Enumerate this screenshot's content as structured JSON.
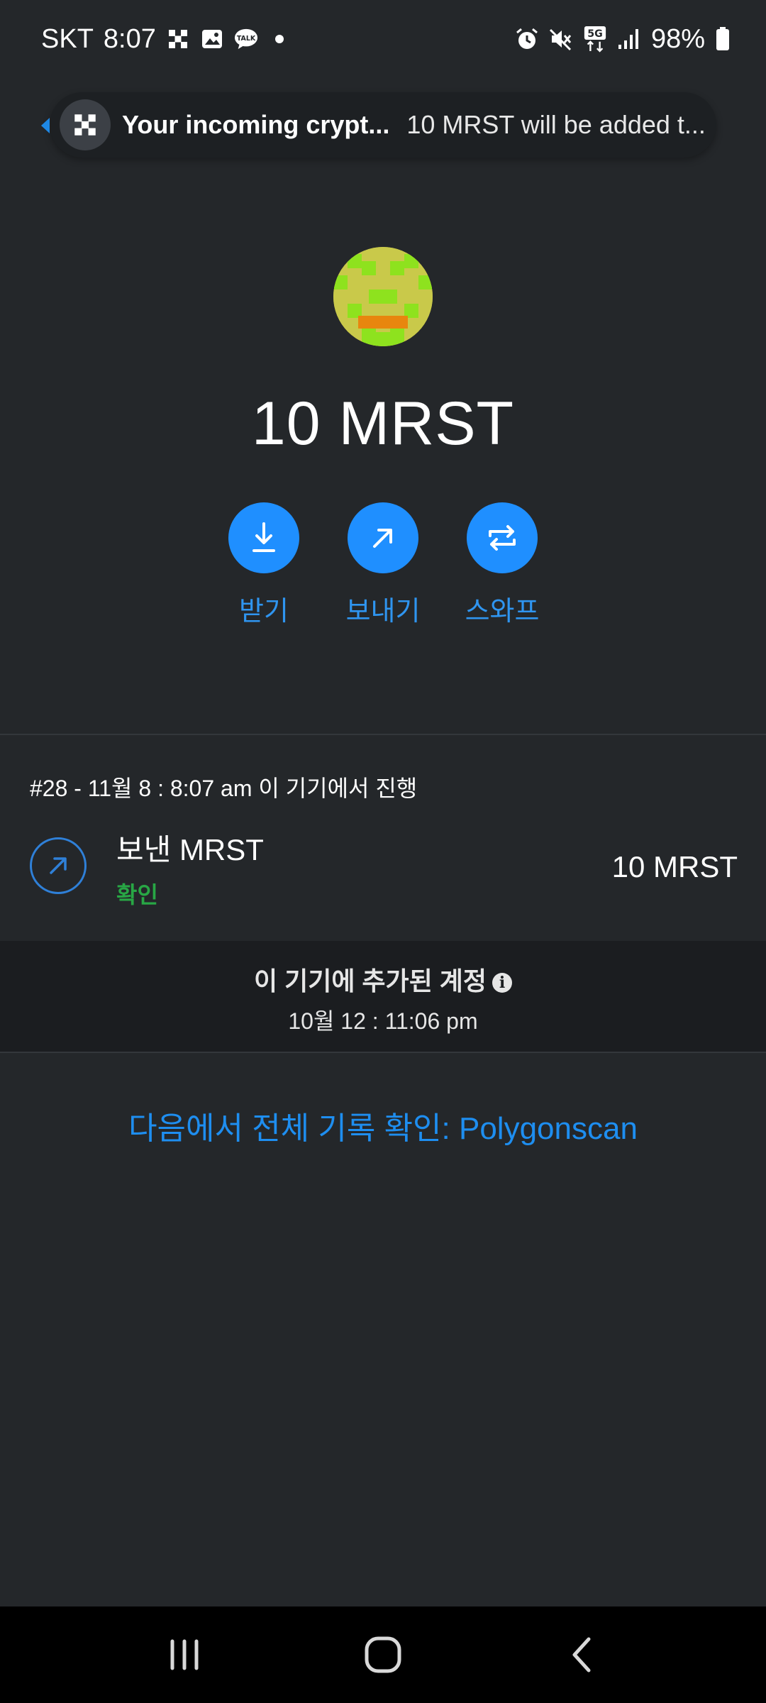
{
  "status_bar": {
    "carrier": "SKT",
    "time": "8:07",
    "battery": "98%",
    "icons_left": [
      "app-notification-icon",
      "gallery-icon",
      "talk-icon",
      "dot-icon"
    ],
    "icons_right": [
      "alarm-icon",
      "mute-icon",
      "5g-icon",
      "signal-icon",
      "battery-icon"
    ]
  },
  "notification": {
    "title": "Your incoming crypt...",
    "body": "10 MRST will be added t..."
  },
  "token": {
    "amount": "10 MRST",
    "avatar_colors": {
      "base": "#c9c94a",
      "accent": "#8ee21e",
      "mouth": "#e8860e"
    }
  },
  "actions": [
    {
      "label": "받기",
      "icon": "download-icon"
    },
    {
      "label": "보내기",
      "icon": "arrow-up-right-icon"
    },
    {
      "label": "스와프",
      "icon": "swap-icon"
    }
  ],
  "transaction": {
    "date_line": "#28 - 11월 8 : 8:07 am 이 기기에서 진행",
    "title": "보낸 MRST",
    "status": "확인",
    "amount": "10 MRST"
  },
  "account_added": {
    "title": "이 기기에 추가된 계정",
    "date": "10월 12 : 11:06 pm"
  },
  "history_link": "다음에서 전체 기록 확인: Polygonscan",
  "colors": {
    "background": "#24272a",
    "accent": "#1f8fff",
    "success": "#28a745"
  }
}
